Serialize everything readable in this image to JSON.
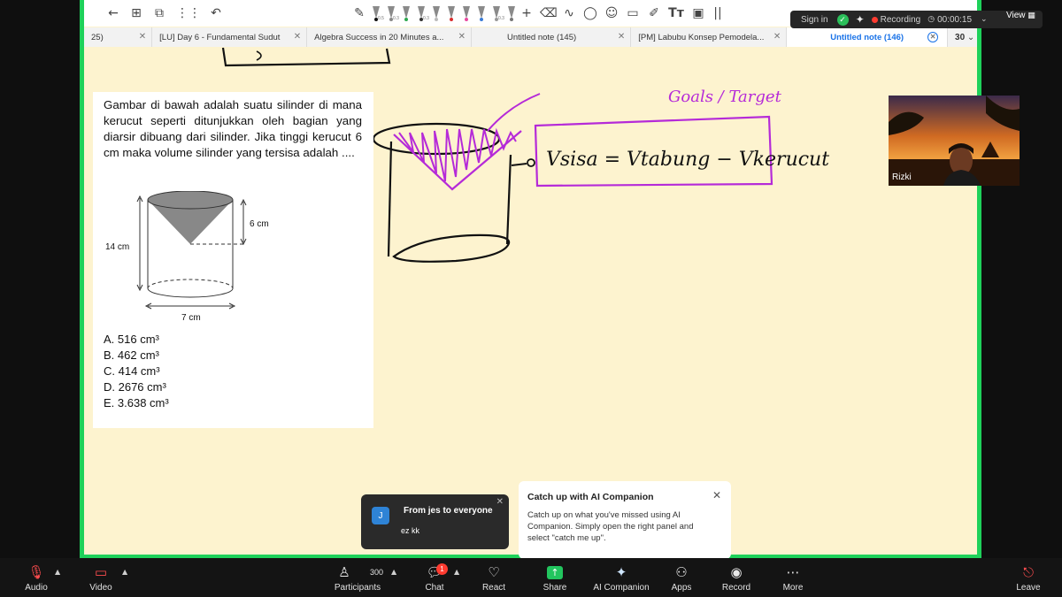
{
  "toolbar": {
    "back_icon": "arrow-left-icon",
    "tools": [
      "grid-icon",
      "crop-icon",
      "apps-grid-icon",
      "undo-icon"
    ],
    "pen_labels": [
      "0.5",
      "0.3",
      "0.3",
      "0.3"
    ],
    "text_tool": "Tт",
    "more": "||"
  },
  "tabs": [
    {
      "label": "25)"
    },
    {
      "label": "[LU] Day 6  - Fundamental Sudut"
    },
    {
      "label": "Algebra Success in 20 Minutes a..."
    },
    {
      "label": "Untitled note (145)"
    },
    {
      "label": "[PM] Labubu Konsep Pemodela..."
    },
    {
      "label": "Untitled note (146)"
    }
  ],
  "tab_count": "30",
  "problem": {
    "text": "Gambar di bawah adalah suatu silinder di mana kerucut seperti ditunjukkan oleh bagian yang diarsir dibuang dari silinder. Jika tinggi kerucut 6 cm maka volume silinder yang tersisa adalah ....",
    "figure": {
      "height_label": "14 cm",
      "cone_label": "6 cm",
      "diameter_label": "7 cm"
    },
    "choices": [
      "A. 516 cm³",
      "B. 462 cm³",
      "C. 414 cm³",
      "D. 2676 cm³",
      "E. 3.638 cm³"
    ]
  },
  "handwriting": {
    "goal": "Goals / Target",
    "formula": "Vsisa = Vtabung − Vkerucut",
    "arrow": "→"
  },
  "zoombar": {
    "sign_in": "Sign in",
    "recording": "Recording",
    "timer": "00:00:15",
    "view": "View"
  },
  "video": {
    "name": "Rizki"
  },
  "chat_popup": {
    "avatar": "J",
    "from": "From jes to everyone",
    "message": "ez kk"
  },
  "ai_popup": {
    "title": "Catch up with AI Companion",
    "body": "Catch up on what you've missed using AI Companion. Simply open the right panel and select \"catch me up\"."
  },
  "controls": {
    "audio": "Audio",
    "video": "Video",
    "participants": "Participants",
    "participants_count": "300",
    "chat": "Chat",
    "chat_badge": "1",
    "react": "React",
    "share": "Share",
    "ai_companion": "AI Companion",
    "apps": "Apps",
    "record": "Record",
    "more": "More",
    "leave": "Leave"
  },
  "colors": {
    "share_border": "#1ed15a",
    "whiteboard": "#fdf3cf",
    "ink_black": "#111111",
    "ink_purple": "#b52ad8",
    "share_button": "#22c55e",
    "leave": "#ff4d4f"
  }
}
